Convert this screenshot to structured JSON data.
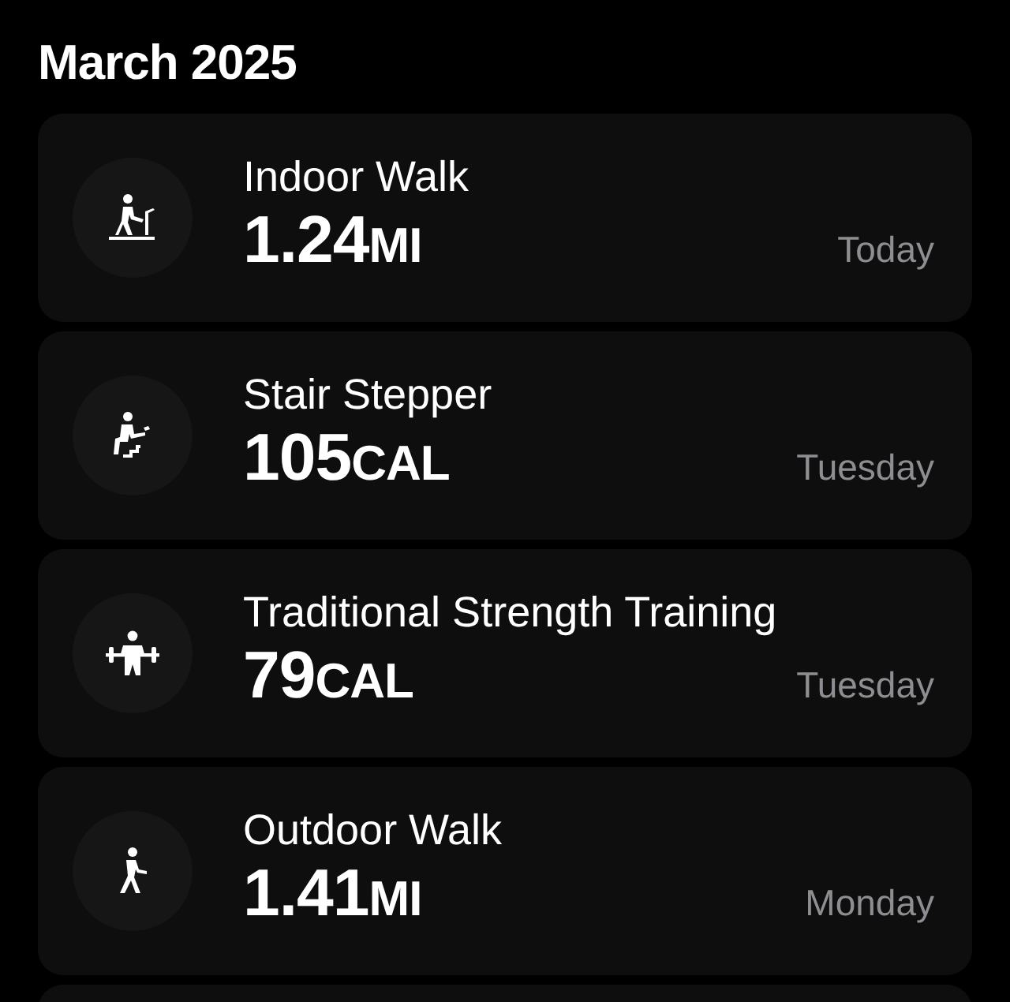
{
  "header": {
    "title": "March 2025"
  },
  "workouts": [
    {
      "kind": "treadmill",
      "name": "Indoor Walk",
      "value": "1.24",
      "unit": "MI",
      "day": "Today"
    },
    {
      "kind": "stairs",
      "name": "Stair Stepper",
      "value": "105",
      "unit": "CAL",
      "day": "Tuesday"
    },
    {
      "kind": "strength",
      "name": "Traditional Strength Training",
      "value": "79",
      "unit": "CAL",
      "day": "Tuesday"
    },
    {
      "kind": "walk",
      "name": "Outdoor Walk",
      "value": "1.41",
      "unit": "MI",
      "day": "Monday"
    }
  ]
}
